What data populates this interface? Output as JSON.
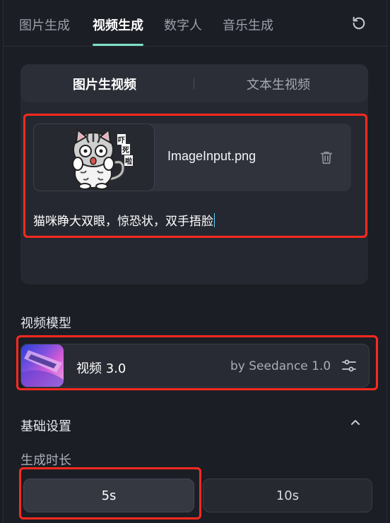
{
  "tabs": [
    {
      "label": "图片生成"
    },
    {
      "label": "视频生成"
    },
    {
      "label": "数字人"
    },
    {
      "label": "音乐生成"
    }
  ],
  "active_tab": "视频生成",
  "mode": {
    "options": [
      "图片生视频",
      "文本生视频"
    ],
    "active": "图片生视频"
  },
  "upload": {
    "file_name": "ImageInput.png",
    "sticker_text": [
      "吓",
      "死",
      "啦"
    ]
  },
  "prompt_text": "猫咪睁大双眼，惊恐状，双手捂脸",
  "model_section": {
    "title": "视频模型",
    "model_name": "视频 3.0",
    "provider": "by Seedance 1.0"
  },
  "basic_settings": {
    "title": "基础设置",
    "duration_label": "生成时长",
    "durations": [
      "5s",
      "10s"
    ],
    "selected_duration": "5s"
  },
  "colors": {
    "accent": "#7fe0c4",
    "highlight_box": "#ff2a1f"
  }
}
